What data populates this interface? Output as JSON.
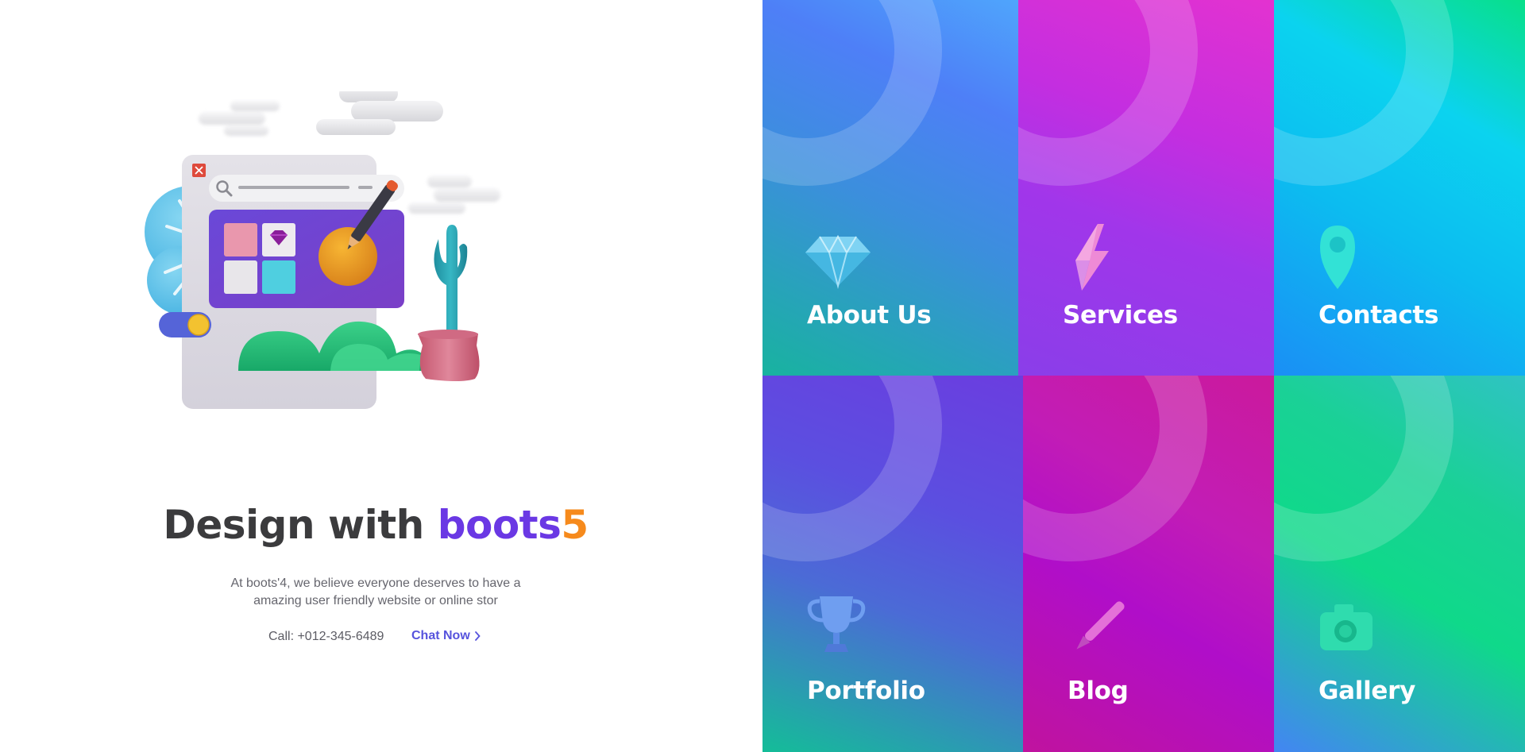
{
  "hero": {
    "title_prefix": "Design with ",
    "title_brand_a": "boots",
    "title_brand_b": "5",
    "description": "At boots'4, we believe everyone deserves to have a amazing user friendly website or online stor",
    "call_text": "Call: +012-345-6489",
    "chat_label": "Chat Now",
    "illustration_name": "web-design-illustration"
  },
  "tiles": [
    {
      "label": "About Us",
      "icon": "diamond-icon",
      "color": "#2aa6c4"
    },
    {
      "label": "Services",
      "icon": "lightning-icon",
      "color": "#b52ee2"
    },
    {
      "label": "Contacts",
      "icon": "location-pin-icon",
      "color": "#0cc0ef"
    },
    {
      "label": "Portfolio",
      "icon": "trophy-icon",
      "color": "#5070d8"
    },
    {
      "label": "Blog",
      "icon": "pen-icon",
      "color": "#c014b4"
    },
    {
      "label": "Gallery",
      "icon": "camera-icon",
      "color": "#1bd49a"
    }
  ],
  "colors": {
    "brand_purple": "#6a38e4",
    "brand_orange": "#f68a1c",
    "link": "#5653dd",
    "heading": "#3b3b3d"
  }
}
